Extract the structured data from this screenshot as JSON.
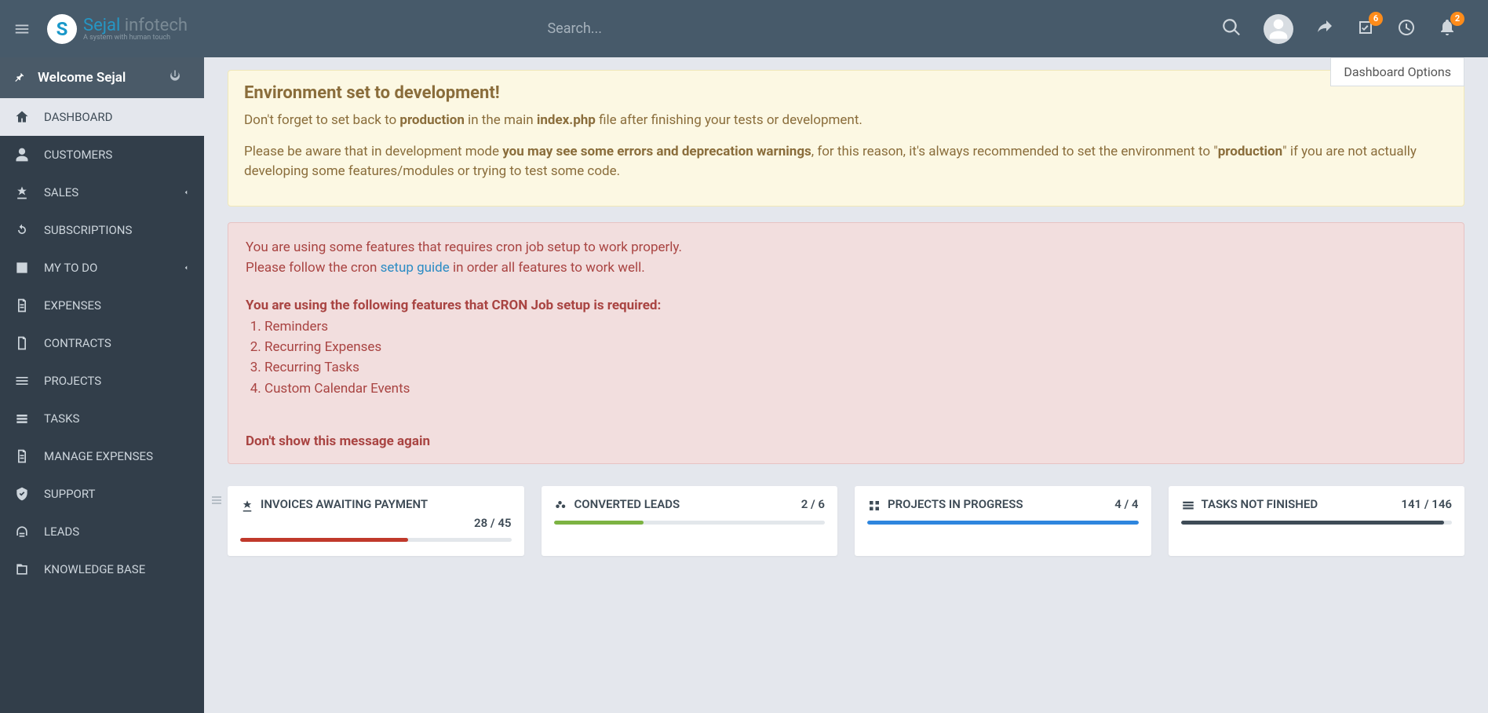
{
  "header": {
    "search_placeholder": "Search...",
    "badges": {
      "checklist": "6",
      "notifications": "2"
    },
    "dashboard_options": "Dashboard Options",
    "logo_main": "Sejal",
    "logo_sub": "infotech",
    "logo_tag": "A system with human touch"
  },
  "sidebar": {
    "welcome": "Welcome Sejal",
    "items": [
      {
        "label": "DASHBOARD",
        "active": true
      },
      {
        "label": "CUSTOMERS"
      },
      {
        "label": "SALES",
        "expandable": true
      },
      {
        "label": "SUBSCRIPTIONS"
      },
      {
        "label": "MY TO DO",
        "expandable": true
      },
      {
        "label": "EXPENSES"
      },
      {
        "label": "CONTRACTS"
      },
      {
        "label": "PROJECTS"
      },
      {
        "label": "TASKS"
      },
      {
        "label": "MANAGE EXPENSES"
      },
      {
        "label": "SUPPORT"
      },
      {
        "label": "LEADS"
      },
      {
        "label": "KNOWLEDGE BASE"
      }
    ]
  },
  "alerts": {
    "env": {
      "title": "Environment set to development!",
      "line1_a": "Don't forget to set back to ",
      "line1_b": "production",
      "line1_c": " in the main ",
      "line1_d": "index.php",
      "line1_e": " file after finishing your tests or development.",
      "line2_a": "Please be aware that in development mode ",
      "line2_b": "you may see some errors and deprecation warnings",
      "line2_c": ", for this reason, it's always recommended to set the environment to \"",
      "line2_d": "production",
      "line2_e": "\" if you are not actually developing some features/modules or trying to test some code."
    },
    "cron": {
      "p1": "You are using some features that requires cron job setup to work properly.",
      "p2a": "Please follow the cron ",
      "p2link": "setup guide",
      "p2b": " in order all features to work well.",
      "heading": "You are using the following features that CRON Job setup is required:",
      "items": [
        "Reminders",
        "Recurring Expenses",
        "Recurring Tasks",
        "Custom Calendar Events"
      ],
      "dismiss": "Don't show this message again"
    }
  },
  "widgets": [
    {
      "title": "INVOICES AWAITING PAYMENT",
      "count": "28 / 45",
      "color": "#c0392b",
      "pct": 62
    },
    {
      "title": "CONVERTED LEADS",
      "count": "2 / 6",
      "color": "#7cb342",
      "pct": 33
    },
    {
      "title": "PROJECTS IN PROGRESS",
      "count": "4 / 4",
      "color": "#2e86de",
      "pct": 100
    },
    {
      "title": "TASKS NOT FINISHED",
      "count": "141 / 146",
      "color": "#3e4b56",
      "pct": 97
    }
  ]
}
